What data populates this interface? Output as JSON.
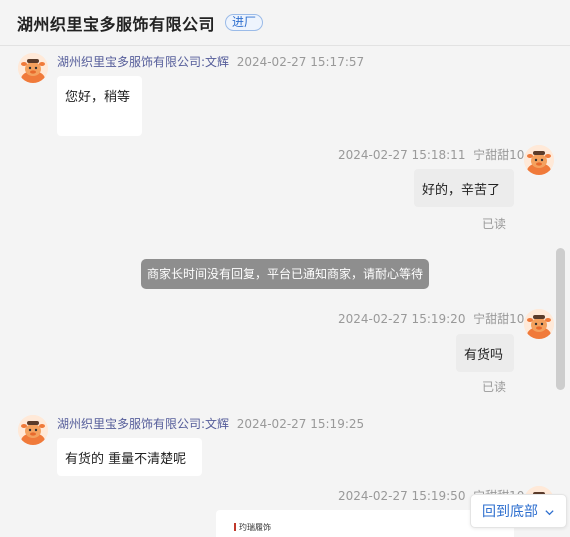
{
  "header": {
    "shop_name": "湖州织里宝多服饰有限公司",
    "enter_shop_label": "进厂"
  },
  "messages": [
    {
      "side": "left",
      "sender": "湖州织里宝多服饰有限公司:文辉",
      "time": "2024-02-27 15:17:57",
      "text": "您好，稍等"
    },
    {
      "side": "right",
      "sender": "宁甜甜10",
      "time": "2024-02-27 15:18:11",
      "text": "好的，辛苦了",
      "status": "已读"
    },
    {
      "side": "system",
      "text": "商家长时间没有回复，平台已通知商家，请耐心等待"
    },
    {
      "side": "right",
      "sender": "宁甜甜10",
      "time": "2024-02-27 15:19:20",
      "text": "有货吗",
      "status": "已读"
    },
    {
      "side": "left",
      "sender": "湖州织里宝多服饰有限公司:文辉",
      "time": "2024-02-27 15:19:25",
      "text": "有货的 重量不清楚呢"
    },
    {
      "side": "right",
      "sender": "宁甜甜10",
      "time": "2024-02-27 15:19:50",
      "card_brand": "玓瑞履饰"
    }
  ],
  "back_to_bottom_label": "回到底部",
  "colors": {
    "accent": "#2e6fcf",
    "sender_name": "#555d9a",
    "system_notice_bg": "#8e8e8e"
  },
  "icons": {
    "avatar": "cartoon-cow-avatar-icon",
    "back_to_bottom": "chevron-down-icon"
  }
}
